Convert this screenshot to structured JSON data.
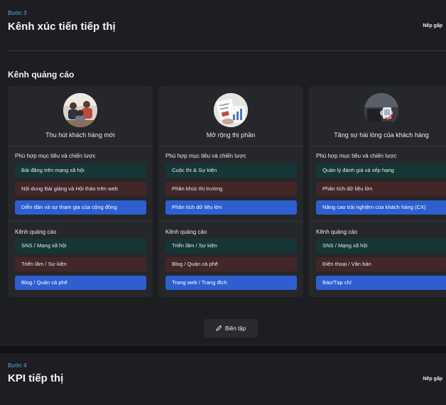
{
  "step3": {
    "label": "Bước 3",
    "title": "Kênh xúc tiến tiếp thị",
    "collapse_label": "Nếp gấp",
    "section_title": "Kênh quảng cáo",
    "cards": [
      {
        "title": "Thu hút khách hàng mới",
        "strategy_label": "Phù hợp mục tiêu và chiến lược",
        "strategies": [
          "Bài đăng trên mạng xã hội",
          "Nội dung Bài giảng và Hội thảo trên web",
          "Diễn đàn và sự tham gia của cộng đồng"
        ],
        "channel_label": "Kênh quảng cáo",
        "channels": [
          "SNS / Mạng xã hội",
          "Triển lãm / Sự kiện",
          "Blog / Quán cà phê"
        ]
      },
      {
        "title": "Mở rộng thị phần",
        "strategy_label": "Phù hợp mục tiêu và chiến lược",
        "strategies": [
          "Cuộc thi & Sự kiện",
          "Phân khúc thị trường",
          "Phân tích dữ liệu lớn"
        ],
        "channel_label": "Kênh quảng cáo",
        "channels": [
          "Triển lãm / Sự kiện",
          "Blog / Quán cà phê",
          "Trang web / Trang đích"
        ]
      },
      {
        "title": "Tăng sự hài lòng của khách hàng",
        "strategy_label": "Phù hợp mục tiêu và chiến lược",
        "strategies": [
          "Quản lý đánh giá và xếp hạng",
          "Phân tích dữ liệu lớn",
          "Nâng cao trải nghiệm của khách hàng (CX)"
        ],
        "channel_label": "Kênh quảng cáo",
        "channels": [
          "SNS / Mạng xã hội",
          "Điện thoại / Văn bản",
          "Báo/Tạp chí"
        ]
      }
    ],
    "edit_label": "Biên tập"
  },
  "step4": {
    "label": "Bước 4",
    "title": "KPI tiếp thị",
    "collapse_label": "Nếp gấp"
  },
  "colors": {
    "accent_cyan": "#58b4d8",
    "chip_teal": "#163536",
    "chip_maroon": "#432627",
    "chip_blue": "#2d5fd0"
  }
}
